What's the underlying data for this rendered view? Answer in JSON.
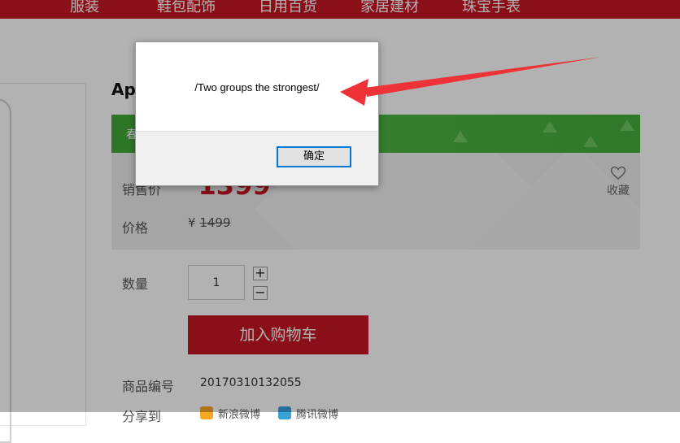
{
  "nav": [
    "服装",
    "鞋包配饰",
    "日用百货",
    "家居建材",
    "珠宝手表"
  ],
  "product": {
    "title": "App",
    "promo_text": "春",
    "sale_label": "销售价",
    "sale_currency": "¥",
    "sale_price": "1399",
    "price_label": "价格",
    "orig_currency": "¥",
    "orig_price": "1499",
    "favorite_label": "收藏",
    "qty_label": "数量",
    "qty_value": "1",
    "qty_plus": "+",
    "qty_minus": "−",
    "add_cart_label": "加入购物车",
    "sku_label": "商品编号",
    "sku_value": "20170310132055",
    "share_label": "分享到",
    "share_items": [
      "新浪微博",
      "腾讯微博"
    ]
  },
  "dialog": {
    "message": "/Two groups the strongest/",
    "ok_label": "确定"
  },
  "colors": {
    "brand_red": "#c81623",
    "promo_green": "#4cb543",
    "annotation_arrow": "#ee3338"
  }
}
